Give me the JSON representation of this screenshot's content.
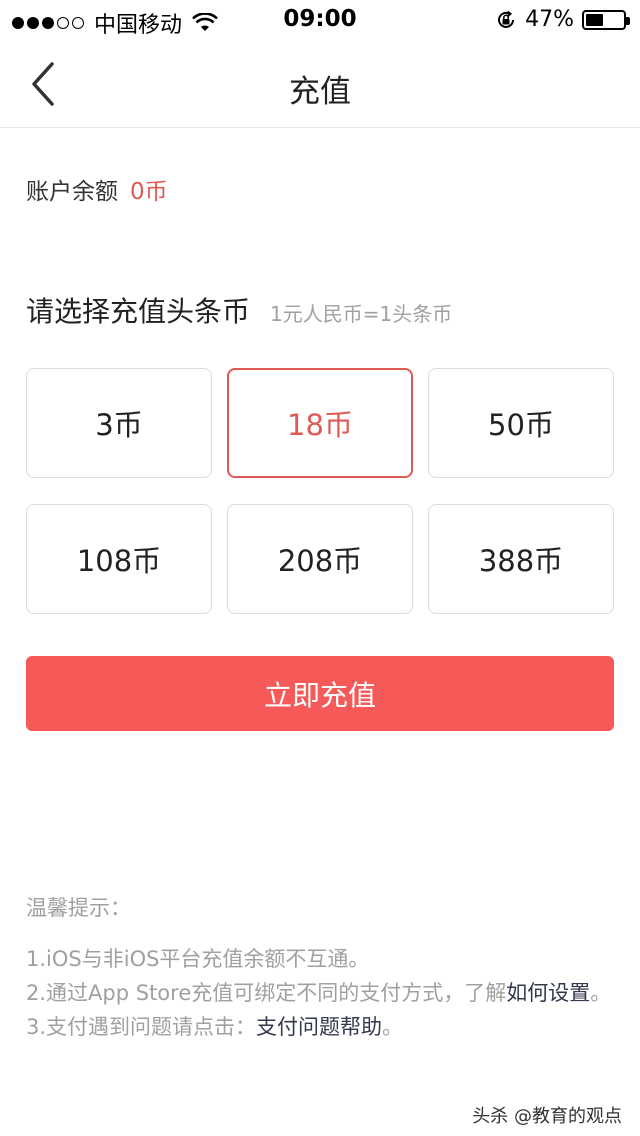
{
  "status_bar": {
    "carrier": "中国移动",
    "time": "09:00",
    "battery_percent_text": "47%",
    "battery_level": 0.47,
    "signal_strength": 3,
    "signal_total": 5
  },
  "nav": {
    "title": "充值",
    "back_icon": "chevron-left-icon"
  },
  "balance": {
    "label": "账户余额",
    "value": "0币"
  },
  "section": {
    "title": "请选择充值头条币",
    "rate": "1元人民币=1头条币"
  },
  "options": [
    {
      "label": "3币",
      "selected": false
    },
    {
      "label": "18币",
      "selected": true
    },
    {
      "label": "50币",
      "selected": false
    },
    {
      "label": "108币",
      "selected": false
    },
    {
      "label": "208币",
      "selected": false
    },
    {
      "label": "388币",
      "selected": false
    }
  ],
  "submit": {
    "label": "立即充值"
  },
  "tips": {
    "title": "温馨提示：",
    "line1": "1.iOS与非iOS平台充值余额不互通。",
    "line2_prefix": "2.通过App Store充值可绑定不同的支付方式，了解",
    "line2_link": "如何设置",
    "line2_suffix": "。",
    "line3_prefix": "3.支付遇到问题请点击：",
    "line3_link": "支付问题帮助",
    "line3_suffix": "。"
  },
  "watermark": "头杀 @教育的观点",
  "colors": {
    "accent": "#f65a58",
    "accent_text": "#e05a55",
    "link": "#333a4d",
    "muted": "#a0a0a0"
  }
}
